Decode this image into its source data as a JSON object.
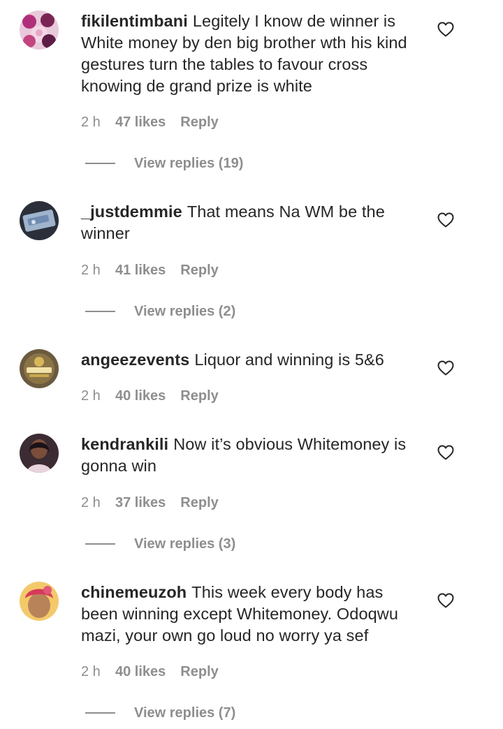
{
  "comments": [
    {
      "username": "fikilentimbani",
      "text": "Legitely I know de winner is White money by den big brother wth his kind gestures turn the tables to favour cross knowing de grand prize is white",
      "time": "2 h",
      "likes": "47 likes",
      "reply": "Reply",
      "view_replies": "View replies (19)",
      "avatar_icon": "profile-photo"
    },
    {
      "username": "_justdemmie",
      "text": "That means Na WM be the winner",
      "time": "2 h",
      "likes": "41 likes",
      "reply": "Reply",
      "view_replies": "View replies (2)",
      "avatar_icon": "profile-photo"
    },
    {
      "username": "angeezevents",
      "text": "Liquor and winning is 5&6",
      "time": "2 h",
      "likes": "40 likes",
      "reply": "Reply",
      "avatar_icon": "profile-photo"
    },
    {
      "username": "kendrankili",
      "text": "Now it’s obvious Whitemoney is gonna win",
      "time": "2 h",
      "likes": "37 likes",
      "reply": "Reply",
      "view_replies": "View replies (3)",
      "avatar_icon": "profile-photo"
    },
    {
      "username": "chinemeuzoh",
      "text": "This week every body has been winning except Whitemoney. Odoqwu mazi, your own go loud no worry ya sef",
      "time": "2 h",
      "likes": "40 likes",
      "reply": "Reply",
      "view_replies": "View replies (7)",
      "avatar_icon": "profile-photo"
    }
  ],
  "icons": {
    "like": "heart-outline-icon"
  },
  "colors": {
    "text": "#262626",
    "secondary": "#8e8e8e",
    "background": "#ffffff"
  }
}
